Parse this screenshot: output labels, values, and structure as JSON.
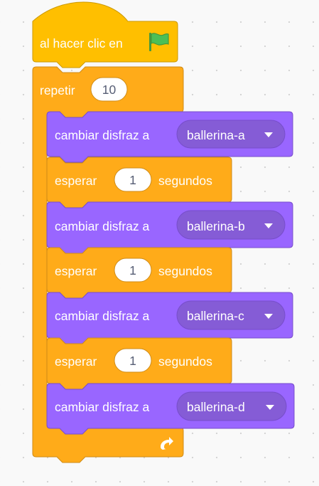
{
  "colors": {
    "events": "#ffbf00",
    "events_border": "#cc9900",
    "control": "#ffab19",
    "control_border": "#cf8b17",
    "looks": "#9966ff",
    "looks_border": "#774dcb",
    "looks_dropdown": "#855cd6",
    "flag_green": "#4cbf56",
    "flag_dark": "#45993d"
  },
  "hat": {
    "label": "al hacer clic en",
    "icon": "green-flag-icon"
  },
  "repeat": {
    "label": "repetir",
    "count": "10",
    "end_icon": "loop-arrow-icon"
  },
  "blocks": [
    {
      "type": "costume",
      "label": "cambiar disfraz a",
      "value": "ballerina-a"
    },
    {
      "type": "wait",
      "label": "esperar",
      "value": "1",
      "suffix": "segundos"
    },
    {
      "type": "costume",
      "label": "cambiar disfraz a",
      "value": "ballerina-b"
    },
    {
      "type": "wait",
      "label": "esperar",
      "value": "1",
      "suffix": "segundos"
    },
    {
      "type": "costume",
      "label": "cambiar disfraz a",
      "value": "ballerina-c"
    },
    {
      "type": "wait",
      "label": "esperar",
      "value": "1",
      "suffix": "segundos"
    },
    {
      "type": "costume",
      "label": "cambiar disfraz a",
      "value": "ballerina-d"
    }
  ]
}
